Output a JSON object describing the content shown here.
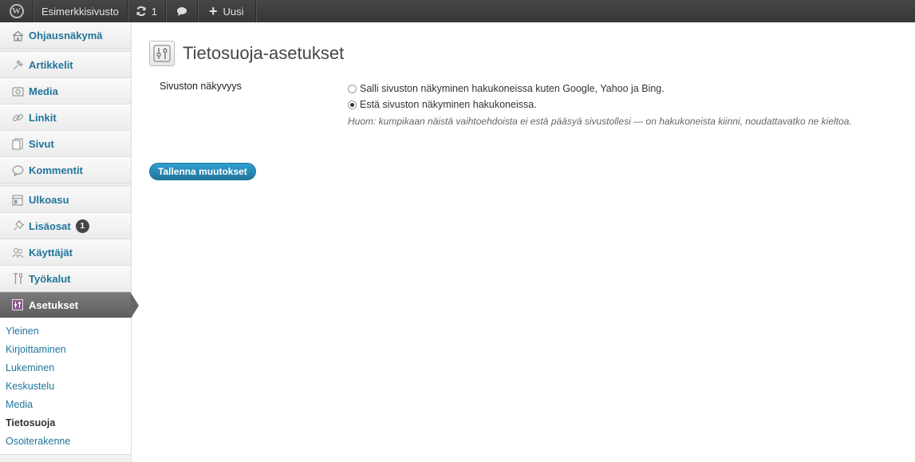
{
  "adminbar": {
    "site_name": "Esimerkkisivusto",
    "updates_count": "1",
    "new_label": "Uusi"
  },
  "sidebar": {
    "items": [
      {
        "label": "Ohjausnäkymä",
        "icon": "home-icon"
      },
      {
        "label": "Artikkelit",
        "icon": "pin-icon"
      },
      {
        "label": "Media",
        "icon": "media-icon"
      },
      {
        "label": "Linkit",
        "icon": "link-icon"
      },
      {
        "label": "Sivut",
        "icon": "pages-icon"
      },
      {
        "label": "Kommentit",
        "icon": "comment-icon"
      },
      {
        "label": "Ulkoasu",
        "icon": "appearance-icon"
      },
      {
        "label": "Lisäosat",
        "icon": "plugin-icon",
        "badge": "1"
      },
      {
        "label": "Käyttäjät",
        "icon": "users-icon"
      },
      {
        "label": "Työkalut",
        "icon": "tools-icon"
      },
      {
        "label": "Asetukset",
        "icon": "settings-icon"
      }
    ],
    "submenu": [
      "Yleinen",
      "Kirjoittaminen",
      "Lukeminen",
      "Keskustelu",
      "Media",
      "Tietosuoja",
      "Osoiterakenne"
    ],
    "current_submenu": "Tietosuoja"
  },
  "main": {
    "title": "Tietosuoja-asetukset",
    "field_label": "Sivuston näkyvyys",
    "option_allow": "Salli sivuston näkyminen hakukoneissa kuten Google, Yahoo ja Bing.",
    "option_block": "Estä sivuston näkyminen hakukoneissa.",
    "selected_option": "block",
    "note": "Huom: kumpikaan näistä vaihtoehdoista ei estä pääsyä sivustollesi — on hakukoneista kiinni, noudattavatko ne kieltoa.",
    "save_label": "Tallenna muutokset"
  },
  "colors": {
    "accent": "#21759b",
    "adminbar": "#464646"
  }
}
